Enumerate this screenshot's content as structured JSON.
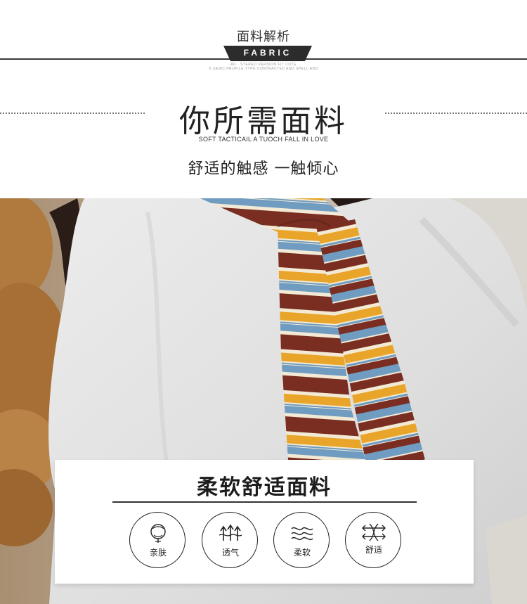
{
  "header": {
    "section_title": "面料解析",
    "ribbon_label": "FABRIC",
    "fine_print_1": "AU · STEREO VERSION FIT CUTE",
    "fine_print_2": "© 3A/BC PROFILE TYPE CONTRACTED AND SPELL ADD",
    "main_title": "你所需面料",
    "english_subtitle": "SOFT TACTICAIL A TUOCH FALL IN LOVE",
    "chinese_subtitle": "舒适的触感 一触倾心"
  },
  "card": {
    "title": "柔软舒适面料",
    "features": [
      {
        "label": "亲肤",
        "icon": "cotton-flower-icon"
      },
      {
        "label": "透气",
        "icon": "breathable-arrows-icon"
      },
      {
        "label": "柔软",
        "icon": "wave-lines-icon"
      },
      {
        "label": "舒适",
        "icon": "comfort-arrows-icon"
      }
    ]
  },
  "colors": {
    "sweater": "#e2e2e2",
    "scarf_rust": "#7a2e22",
    "scarf_mustard": "#e8a52a",
    "scarf_blue": "#6f9cc0",
    "scarf_cream": "#f3ead6"
  }
}
